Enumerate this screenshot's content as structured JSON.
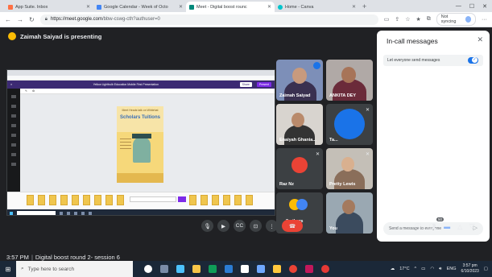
{
  "browser": {
    "tabs": [
      {
        "icon": "mail-icon",
        "color": "#ff7043",
        "label": "App Suite. Inbox",
        "active": false
      },
      {
        "icon": "calendar-icon",
        "color": "#4285f4",
        "label": "Google Calendar - Week of Octo",
        "active": false
      },
      {
        "icon": "meet-icon",
        "color": "#00897b",
        "label": "Meet - Digital boost rounc",
        "active": true
      },
      {
        "icon": "canva-icon",
        "color": "#00c4cc",
        "label": "Home - Canva",
        "active": false
      }
    ],
    "new_tab": "+",
    "url_host": "https://meet.google.com",
    "url_path": "/bbw-cswg-cth?authuser=0",
    "sync_label": "Not syncing"
  },
  "meet": {
    "presenter_text": "Zaimah Saiyad is presenting",
    "meeting_time": "3:57 PM",
    "meeting_name": "Digital boost round 2- session 6",
    "participants_count": "50",
    "participants": [
      {
        "name": "Zaimah Saiyad",
        "video": true,
        "speaking": true
      },
      {
        "name": "ANKITA DEY",
        "video": true,
        "speaking": false
      },
      {
        "name": "Enaiyah Ghania...",
        "video": true,
        "speaking": false
      },
      {
        "name": "Ta...",
        "video": false,
        "speaking": false
      },
      {
        "name": "Raz Nz",
        "video": false,
        "speaking": false
      },
      {
        "name": "Pretty Lewis",
        "video": true,
        "speaking": false
      },
      {
        "name": "2 others",
        "video": false,
        "speaking": false
      },
      {
        "name": "You",
        "video": true,
        "speaking": false
      }
    ]
  },
  "shared_screen": {
    "toolbar_title": "Yellow Lightbulb Education Mobile First Presentation",
    "share_label": "Share",
    "present_label": "Present",
    "poster_top": "Meet Heads talk on Whitehat",
    "poster_title": "Scholars Tuitions"
  },
  "chat": {
    "title": "In-call messages",
    "setting_label": "Let everyone send messages",
    "input_placeholder": "Send a message to everyone"
  },
  "taskbar": {
    "search_placeholder": "Type here to search",
    "temperature": "17°C",
    "lang": "ENG",
    "time": "3:57 pm",
    "date": "6/10/2023"
  }
}
